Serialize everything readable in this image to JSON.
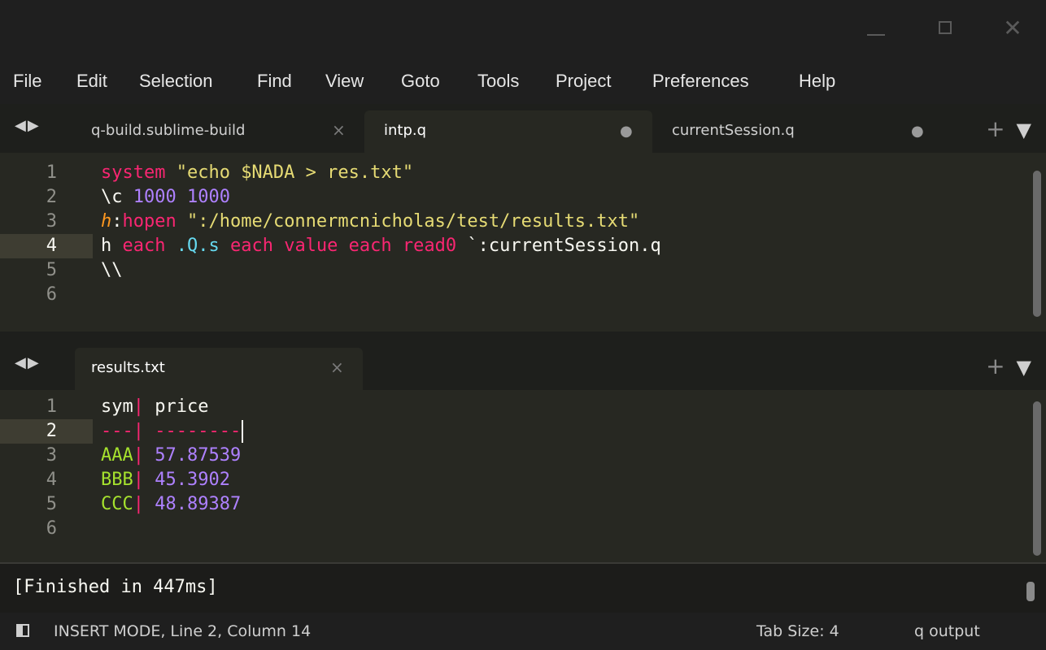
{
  "window": {
    "controls": [
      "minimize-icon",
      "maximize-icon",
      "close-icon"
    ],
    "close_glyph": "✕"
  },
  "menu": [
    "File",
    "Edit",
    "Selection",
    "Find",
    "View",
    "Goto",
    "Tools",
    "Project",
    "Preferences",
    "Help"
  ],
  "top_tabs": [
    {
      "label": "q-build.sublime-build",
      "state": "×"
    },
    {
      "label": "intp.q",
      "state": "●"
    },
    {
      "label": "currentSession.q",
      "state": "●"
    }
  ],
  "top_editor": {
    "line_numbers": [
      "1",
      "2",
      "3",
      "4",
      "5",
      "6"
    ],
    "current_line": 4,
    "lines": [
      [
        {
          "t": "system ",
          "c": "kw"
        },
        {
          "t": "\"echo $NADA > res.txt\"",
          "c": "str"
        }
      ],
      [
        {
          "t": "\\c ",
          "c": ""
        },
        {
          "t": "1000 1000",
          "c": "num"
        }
      ],
      [
        {
          "t": "h",
          "c": "def"
        },
        {
          "t": ":",
          "c": ""
        },
        {
          "t": "hopen ",
          "c": "kw"
        },
        {
          "t": "\":/home/connermcnicholas/test/results.txt\"",
          "c": "str"
        }
      ],
      [
        {
          "t": "h ",
          "c": ""
        },
        {
          "t": "each ",
          "c": "kw"
        },
        {
          "t": ".Q.s ",
          "c": "cy"
        },
        {
          "t": "each value each read0 ",
          "c": "kw"
        },
        {
          "t": "`:currentSession.q",
          "c": ""
        }
      ],
      [
        {
          "t": "\\\\",
          "c": ""
        }
      ],
      []
    ]
  },
  "bottom_tabs": [
    {
      "label": "results.txt",
      "state": "×"
    }
  ],
  "tab_controls": {
    "plus": "+",
    "dropdown": "▼"
  },
  "nav_arrows": "◀▶",
  "bottom_editor": {
    "line_numbers": [
      "1",
      "2",
      "3",
      "4",
      "5",
      "6"
    ],
    "current_line": 2,
    "lines": [
      [
        {
          "t": "sym",
          "c": ""
        },
        {
          "t": "|",
          "c": "pk"
        },
        {
          "t": " price",
          "c": ""
        }
      ],
      [
        {
          "t": "---",
          "c": "pk"
        },
        {
          "t": "|",
          "c": "pk"
        },
        {
          "t": " --------",
          "c": "pk"
        }
      ],
      [
        {
          "t": "AAA",
          "c": "gr"
        },
        {
          "t": "|",
          "c": "pk"
        },
        {
          "t": " 57.87539",
          "c": "pu"
        }
      ],
      [
        {
          "t": "BBB",
          "c": "gr"
        },
        {
          "t": "|",
          "c": "pk"
        },
        {
          "t": " 45.3902",
          "c": "pu"
        }
      ],
      [
        {
          "t": "CCC",
          "c": "gr"
        },
        {
          "t": "|",
          "c": "pk"
        },
        {
          "t": " 48.89387",
          "c": "pu"
        }
      ],
      []
    ]
  },
  "output": {
    "text": "[Finished in 447ms]"
  },
  "status": {
    "mode": "INSERT MODE, Line 2, Column 14",
    "tab_size": "Tab Size: 4",
    "syntax": "q output"
  }
}
